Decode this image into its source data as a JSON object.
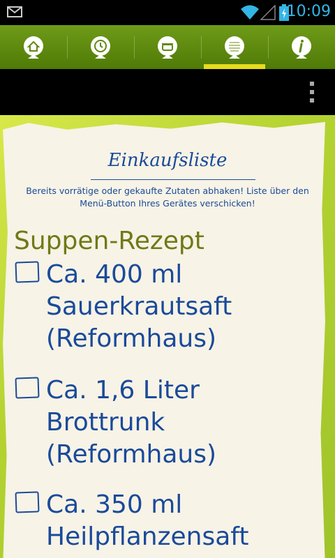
{
  "status_bar": {
    "time": "10:09",
    "icons": [
      "gmail-icon",
      "wifi-icon",
      "signal-icon",
      "battery-charging-icon"
    ]
  },
  "tabs": [
    {
      "name": "home",
      "icon": "house-icon",
      "selected": false
    },
    {
      "name": "timer",
      "icon": "clock-icon",
      "selected": false
    },
    {
      "name": "cooking",
      "icon": "pot-icon",
      "selected": false
    },
    {
      "name": "shopping-list",
      "icon": "list-badge-icon",
      "selected": true
    },
    {
      "name": "info",
      "icon": "info-icon",
      "selected": false
    }
  ],
  "colors": {
    "tab_bar": "#5f8a0f",
    "tab_indicator": "#e5dc1c",
    "text_blue": "#1a4a9a",
    "title_olive": "#6e7a16",
    "paper": "#f7f3e6",
    "clock": "#33b5e5"
  },
  "page": {
    "heading": "Einkaufsliste",
    "hint": "Bereits vorrätige oder gekaufte Zutaten abhaken! Liste über den Menü-Button Ihres Gerätes verschicken!",
    "recipe_title": "Suppen-Rezept"
  },
  "ingredients": [
    {
      "line1": "Ca. 400  ml",
      "line2": "Sauerkrautsaft",
      "line3": "(Reformhaus)",
      "checked": false
    },
    {
      "line1": "Ca. 1,6  Liter",
      "line2": "Brottrunk",
      "line3": "(Reformhaus)",
      "checked": false
    },
    {
      "line1": "Ca. 350  ml",
      "line2": "Heilpflanzensaft",
      "line3": "",
      "checked": false
    }
  ]
}
